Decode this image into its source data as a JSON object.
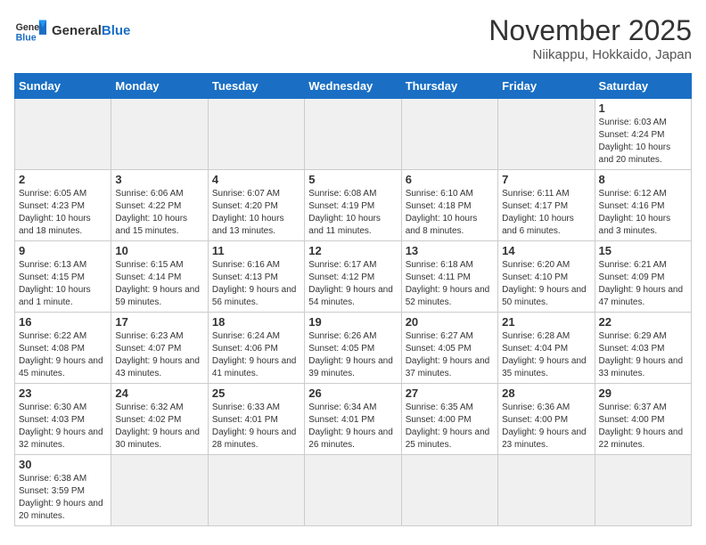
{
  "header": {
    "logo_general": "General",
    "logo_blue": "Blue",
    "month_title": "November 2025",
    "location": "Niikappu, Hokkaido, Japan"
  },
  "days_of_week": [
    "Sunday",
    "Monday",
    "Tuesday",
    "Wednesday",
    "Thursday",
    "Friday",
    "Saturday"
  ],
  "weeks": [
    [
      {
        "day": "",
        "info": ""
      },
      {
        "day": "",
        "info": ""
      },
      {
        "day": "",
        "info": ""
      },
      {
        "day": "",
        "info": ""
      },
      {
        "day": "",
        "info": ""
      },
      {
        "day": "",
        "info": ""
      },
      {
        "day": "1",
        "info": "Sunrise: 6:03 AM\nSunset: 4:24 PM\nDaylight: 10 hours\nand 20 minutes."
      }
    ],
    [
      {
        "day": "2",
        "info": "Sunrise: 6:05 AM\nSunset: 4:23 PM\nDaylight: 10 hours\nand 18 minutes."
      },
      {
        "day": "3",
        "info": "Sunrise: 6:06 AM\nSunset: 4:22 PM\nDaylight: 10 hours\nand 15 minutes."
      },
      {
        "day": "4",
        "info": "Sunrise: 6:07 AM\nSunset: 4:20 PM\nDaylight: 10 hours\nand 13 minutes."
      },
      {
        "day": "5",
        "info": "Sunrise: 6:08 AM\nSunset: 4:19 PM\nDaylight: 10 hours\nand 11 minutes."
      },
      {
        "day": "6",
        "info": "Sunrise: 6:10 AM\nSunset: 4:18 PM\nDaylight: 10 hours\nand 8 minutes."
      },
      {
        "day": "7",
        "info": "Sunrise: 6:11 AM\nSunset: 4:17 PM\nDaylight: 10 hours\nand 6 minutes."
      },
      {
        "day": "8",
        "info": "Sunrise: 6:12 AM\nSunset: 4:16 PM\nDaylight: 10 hours\nand 3 minutes."
      }
    ],
    [
      {
        "day": "9",
        "info": "Sunrise: 6:13 AM\nSunset: 4:15 PM\nDaylight: 10 hours\nand 1 minute."
      },
      {
        "day": "10",
        "info": "Sunrise: 6:15 AM\nSunset: 4:14 PM\nDaylight: 9 hours\nand 59 minutes."
      },
      {
        "day": "11",
        "info": "Sunrise: 6:16 AM\nSunset: 4:13 PM\nDaylight: 9 hours\nand 56 minutes."
      },
      {
        "day": "12",
        "info": "Sunrise: 6:17 AM\nSunset: 4:12 PM\nDaylight: 9 hours\nand 54 minutes."
      },
      {
        "day": "13",
        "info": "Sunrise: 6:18 AM\nSunset: 4:11 PM\nDaylight: 9 hours\nand 52 minutes."
      },
      {
        "day": "14",
        "info": "Sunrise: 6:20 AM\nSunset: 4:10 PM\nDaylight: 9 hours\nand 50 minutes."
      },
      {
        "day": "15",
        "info": "Sunrise: 6:21 AM\nSunset: 4:09 PM\nDaylight: 9 hours\nand 47 minutes."
      }
    ],
    [
      {
        "day": "16",
        "info": "Sunrise: 6:22 AM\nSunset: 4:08 PM\nDaylight: 9 hours\nand 45 minutes."
      },
      {
        "day": "17",
        "info": "Sunrise: 6:23 AM\nSunset: 4:07 PM\nDaylight: 9 hours\nand 43 minutes."
      },
      {
        "day": "18",
        "info": "Sunrise: 6:24 AM\nSunset: 4:06 PM\nDaylight: 9 hours\nand 41 minutes."
      },
      {
        "day": "19",
        "info": "Sunrise: 6:26 AM\nSunset: 4:05 PM\nDaylight: 9 hours\nand 39 minutes."
      },
      {
        "day": "20",
        "info": "Sunrise: 6:27 AM\nSunset: 4:05 PM\nDaylight: 9 hours\nand 37 minutes."
      },
      {
        "day": "21",
        "info": "Sunrise: 6:28 AM\nSunset: 4:04 PM\nDaylight: 9 hours\nand 35 minutes."
      },
      {
        "day": "22",
        "info": "Sunrise: 6:29 AM\nSunset: 4:03 PM\nDaylight: 9 hours\nand 33 minutes."
      }
    ],
    [
      {
        "day": "23",
        "info": "Sunrise: 6:30 AM\nSunset: 4:03 PM\nDaylight: 9 hours\nand 32 minutes."
      },
      {
        "day": "24",
        "info": "Sunrise: 6:32 AM\nSunset: 4:02 PM\nDaylight: 9 hours\nand 30 minutes."
      },
      {
        "day": "25",
        "info": "Sunrise: 6:33 AM\nSunset: 4:01 PM\nDaylight: 9 hours\nand 28 minutes."
      },
      {
        "day": "26",
        "info": "Sunrise: 6:34 AM\nSunset: 4:01 PM\nDaylight: 9 hours\nand 26 minutes."
      },
      {
        "day": "27",
        "info": "Sunrise: 6:35 AM\nSunset: 4:00 PM\nDaylight: 9 hours\nand 25 minutes."
      },
      {
        "day": "28",
        "info": "Sunrise: 6:36 AM\nSunset: 4:00 PM\nDaylight: 9 hours\nand 23 minutes."
      },
      {
        "day": "29",
        "info": "Sunrise: 6:37 AM\nSunset: 4:00 PM\nDaylight: 9 hours\nand 22 minutes."
      }
    ],
    [
      {
        "day": "30",
        "info": "Sunrise: 6:38 AM\nSunset: 3:59 PM\nDaylight: 9 hours\nand 20 minutes."
      },
      {
        "day": "",
        "info": ""
      },
      {
        "day": "",
        "info": ""
      },
      {
        "day": "",
        "info": ""
      },
      {
        "day": "",
        "info": ""
      },
      {
        "day": "",
        "info": ""
      },
      {
        "day": "",
        "info": ""
      }
    ]
  ]
}
